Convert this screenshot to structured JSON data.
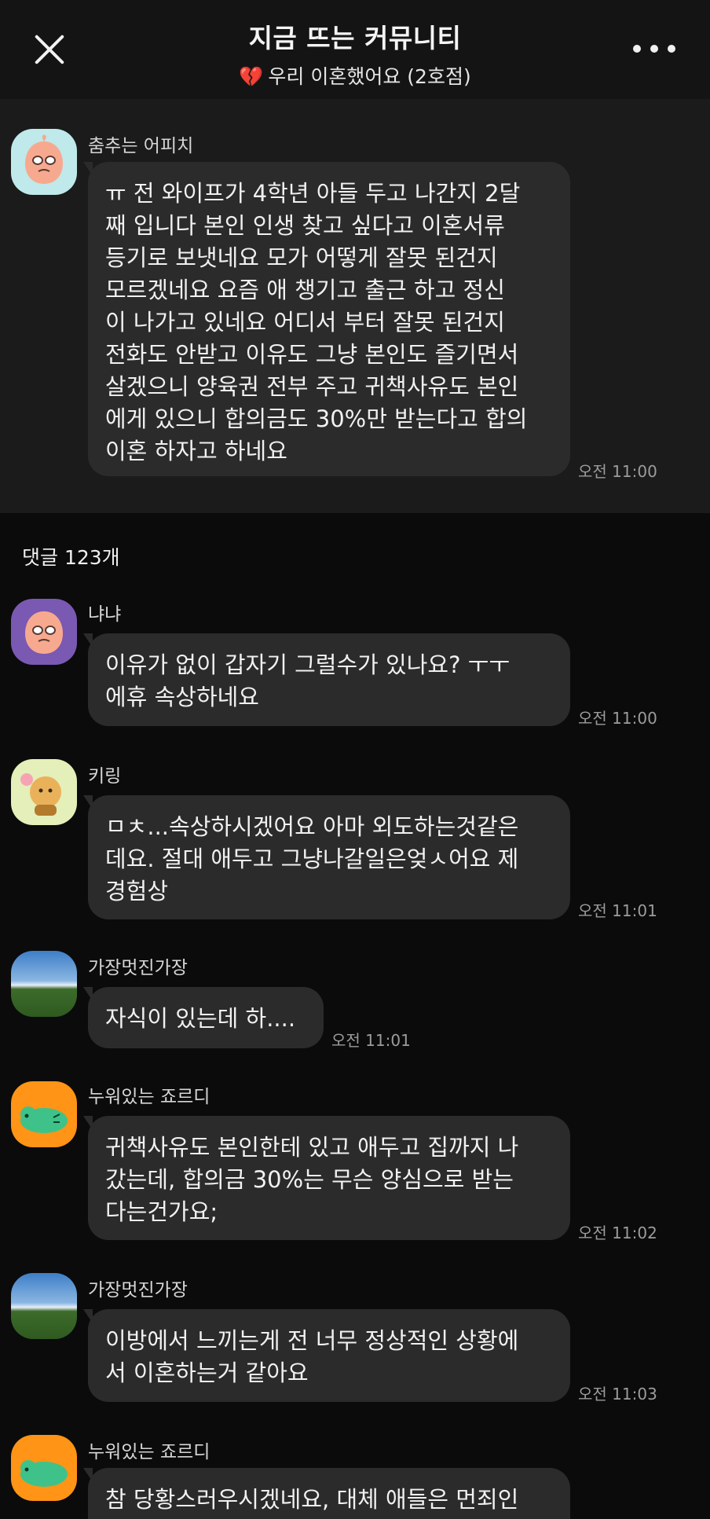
{
  "header": {
    "title": "지금 뜨는 커뮤니티",
    "subtitle_icon": "broken-heart",
    "subtitle_icon_glyph": "💔",
    "subtitle": "우리 이혼했어요 (2호점)"
  },
  "post": {
    "author": "춤추는 어피치",
    "text": "ㅠ 전 와이프가 4학년 아들  두고 나간지 2달\n째 입니다 본인 인생 찾고 싶다고 이혼서류\n등기로 보냇네요 모가 어떻게 잘못 된건지\n모르겠네요 요즘 애  챙기고 출근 하고 정신\n이 나가고 있네요 어디서 부터 잘못 된건지\n전화도 안받고 이유도 그냥 본인도 즐기면서\n살겠으니 양육권 전부 주고 귀책사유도 본인\n에게 있으니 합의금도 30%만 받는다고 합의\n이혼 하자고 하네요",
    "time": "오전 11:00"
  },
  "comments_label": "댓글 123개",
  "comments": [
    {
      "author": "냐냐",
      "text": "이유가 없이 갑자기 그럴수가 있나요? ㅜㅜ\n에휴 속상하네요",
      "time": "오전 11:00"
    },
    {
      "author": "키링",
      "text": "ㅁㅊ...속상하시겠어요 아마 외도하는것같은\n데요. 절대 애두고 그냥나갈일은엊ㅅ어요 제\n경험상",
      "time": "오전 11:01"
    },
    {
      "author": "가장멋진가장",
      "text": "자식이 있는데 하....",
      "time": "오전 11:01"
    },
    {
      "author": "누워있는 죠르디",
      "text": "귀책사유도 본인한테 있고 애두고 집까지 나\n갔는데, 합의금 30%는 무슨 양심으로 받는\n다는건가요;",
      "time": "오전 11:02"
    },
    {
      "author": "가장멋진가장",
      "text": "이방에서 느끼는게 전 너무 정상적인 상황에\n서 이혼하는거 같아요",
      "time": "오전 11:03"
    },
    {
      "author": "누워있는 죠르디",
      "text": "참 당황스러우시겠네요, 대체 애들은 먼죄인",
      "time": ""
    }
  ],
  "colors": {
    "background": "#0b0b0b",
    "header": "#141414",
    "post_section": "#1b1b1b",
    "bubble": "#2b2b2b",
    "heart": "#ff4f7a"
  }
}
